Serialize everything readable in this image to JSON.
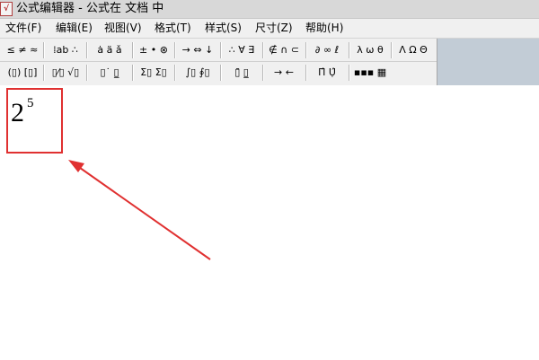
{
  "window": {
    "title": "公式编辑器 - 公式在 文档 中",
    "icon": "equation-editor-app-icon"
  },
  "menu": [
    {
      "label": "文件(F)"
    },
    {
      "label": "编辑(E)"
    },
    {
      "label": "视图(V)"
    },
    {
      "label": "格式(T)"
    },
    {
      "label": "样式(S)"
    },
    {
      "label": "尺寸(Z)"
    },
    {
      "label": "帮助(H)"
    }
  ],
  "toolbar": {
    "row1": [
      {
        "glyph": "≤ ≠ ≈",
        "icon": "relational-symbols-icon"
      },
      {
        "glyph": "⁞ab ∴",
        "icon": "spaces-ellipses-icon"
      },
      {
        "glyph": "ȧ ä ǎ",
        "icon": "embellishments-icon"
      },
      {
        "glyph": "± • ⊗",
        "icon": "operator-symbols-icon"
      },
      {
        "glyph": "→ ⇔ ↓",
        "icon": "arrow-symbols-icon"
      },
      {
        "glyph": "∴ ∀ ∃",
        "icon": "logical-symbols-icon"
      },
      {
        "glyph": "∉ ∩ ⊂",
        "icon": "set-theory-symbols-icon"
      },
      {
        "glyph": "∂ ∞ ℓ",
        "icon": "misc-symbols-icon"
      },
      {
        "glyph": "λ ω θ",
        "icon": "greek-lowercase-icon"
      },
      {
        "glyph": "Λ Ω Θ",
        "icon": "greek-uppercase-icon"
      }
    ],
    "row2": [
      {
        "glyph": "(▯) [▯]",
        "icon": "fence-templates-icon"
      },
      {
        "glyph": "▯⁄▯ √▯",
        "icon": "fraction-radical-templates-icon"
      },
      {
        "glyph": "▯˙ ▯̲",
        "icon": "subscript-superscript-templates-icon"
      },
      {
        "glyph": "Σ▯ Σ▯",
        "icon": "summation-templates-icon"
      },
      {
        "glyph": "∫▯ ∮▯",
        "icon": "integral-templates-icon"
      },
      {
        "glyph": "▯̄ ▯̲",
        "icon": "underbar-overbar-templates-icon"
      },
      {
        "glyph": "→ ←",
        "icon": "labeled-arrow-templates-icon"
      },
      {
        "glyph": "Π̂ Ụ̂",
        "icon": "products-set-theory-templates-icon"
      },
      {
        "glyph": "▪▪▪ ▦",
        "icon": "matrix-templates-icon"
      }
    ]
  },
  "equation": {
    "base": "2",
    "exponent": "5"
  },
  "annotation": {
    "color": "#e03030"
  }
}
